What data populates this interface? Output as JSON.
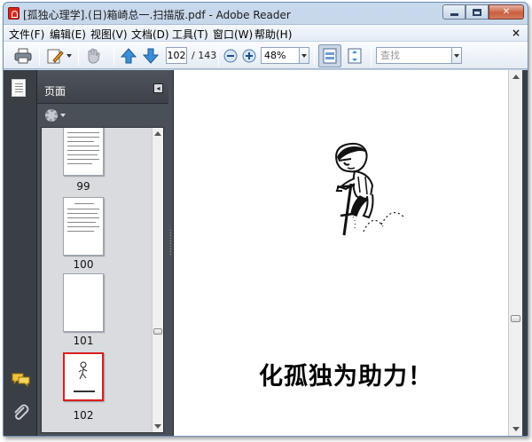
{
  "window": {
    "title": "[孤独心理学].(日)箱崎总一.扫描版.pdf - Adobe Reader"
  },
  "menu": {
    "items": [
      "文件(F)",
      "编辑(E)",
      "视图(V)",
      "文档(D)",
      "工具(T)",
      "窗口(W)",
      "帮助(H)"
    ],
    "close_glyph": "×"
  },
  "toolbar": {
    "current_page": "102",
    "page_of": "/ 143",
    "zoom": "48%",
    "find_placeholder": "查找"
  },
  "panel": {
    "title": "页面",
    "thumbnails": [
      {
        "label": "99",
        "selected": false
      },
      {
        "label": "100",
        "selected": false
      },
      {
        "label": "101",
        "selected": false
      },
      {
        "label": "102",
        "selected": true
      }
    ]
  },
  "document": {
    "headline": "化孤独为助力！"
  },
  "icons": {
    "app": "pdf-icon",
    "print": "printer-icon",
    "edit": "edit-icon",
    "nav": "hand-icon",
    "prev": "up-arrow-icon",
    "next": "down-arrow-icon",
    "zoom_out": "zoom-out-icon",
    "zoom_in": "zoom-in-icon",
    "fit_width": "fit-width-icon",
    "fit_page": "fit-page-icon"
  }
}
